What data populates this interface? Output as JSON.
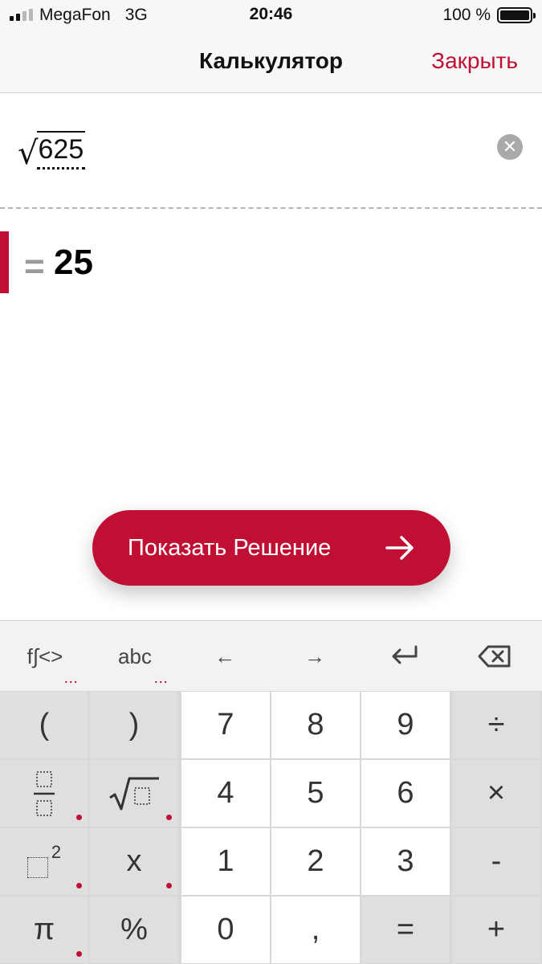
{
  "status": {
    "carrier": "MegaFon",
    "network": "3G",
    "time": "20:46",
    "battery": "100 %",
    "battery_level": 1.0
  },
  "nav": {
    "title": "Калькулятор",
    "close_label": "Закрыть"
  },
  "input": {
    "radicand": "625",
    "clear_icon": "clear-icon"
  },
  "result": {
    "equals": "=",
    "value": "25"
  },
  "solution_button": {
    "label": "Показать Решение",
    "icon": "arrow-right-icon"
  },
  "keyboard": {
    "top_row": {
      "functions": "f∫<>",
      "functions_dots": "...",
      "letters": "abc",
      "letters_dots": "...",
      "left": "←",
      "right": "→",
      "enter_icon": "enter-icon",
      "backspace_icon": "backspace-icon"
    },
    "keys": {
      "open_paren": "(",
      "close_paren": ")",
      "seven": "7",
      "eight": "8",
      "nine": "9",
      "divide": "÷",
      "four": "4",
      "five": "5",
      "six": "6",
      "multiply": "×",
      "square_exponent": "2",
      "x": "x",
      "one": "1",
      "two": "2",
      "three": "3",
      "minus": "-",
      "pi": "π",
      "percent": "%",
      "zero": "0",
      "comma": ",",
      "equals": "=",
      "plus": "+"
    }
  },
  "colors": {
    "accent": "#c10f34",
    "key_gray": "#dfdfdf",
    "key_white": "#ffffff"
  }
}
